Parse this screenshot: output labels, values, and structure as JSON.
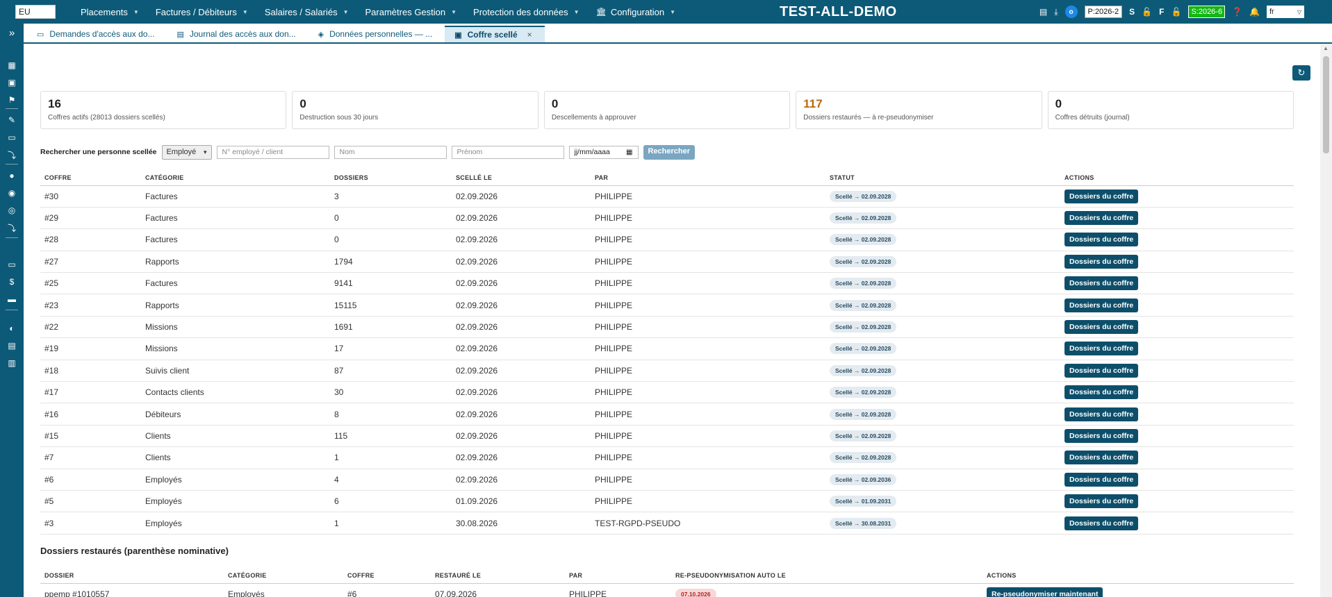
{
  "topbar": {
    "company": "EU",
    "menu": [
      {
        "label": "Placements"
      },
      {
        "label": "Factures / Débiteurs"
      },
      {
        "label": "Salaires / Salariés"
      },
      {
        "label": "Paramètres Gestion"
      },
      {
        "label": "Protection des données"
      },
      {
        "label": "Configuration"
      }
    ],
    "app_title": "TEST-ALL-DEMO",
    "avatar_initial": "o",
    "period": "P:2026-2",
    "s_label": "S",
    "f_label": "F",
    "session": "S:2026-6",
    "language": "fr"
  },
  "tabs": [
    {
      "label": "Demandes d'accès aux do...",
      "icon": "laptop-icon"
    },
    {
      "label": "Journal des accès aux don...",
      "icon": "document-icon"
    },
    {
      "label": "Données personnelles — ...",
      "icon": "shield-icon"
    },
    {
      "label": "Coffre scellé",
      "icon": "vault-icon",
      "active": true
    }
  ],
  "kpis": [
    {
      "value": "16",
      "label": "Coffres actifs (28013 dossiers scellés)"
    },
    {
      "value": "0",
      "label": "Destruction sous 30 jours"
    },
    {
      "value": "0",
      "label": "Descellements à approuver"
    },
    {
      "value": "117",
      "label": "Dossiers restaurés — à re-pseudonymiser",
      "color": "#b86a0a"
    },
    {
      "value": "0",
      "label": "Coffres détruits (journal)"
    }
  ],
  "search": {
    "label": "Rechercher une personne scellée",
    "type_value": "Employé",
    "number_placeholder": "N° employé / client",
    "name_placeholder": "Nom",
    "firstname_placeholder": "Prénom",
    "date_placeholder": "jj/mm/aaaa",
    "button": "Rechercher"
  },
  "vaults_table": {
    "headers": [
      "Coffre",
      "Catégorie",
      "Dossiers",
      "Scellé le",
      "Par",
      "Statut",
      "Actions"
    ],
    "action_label": "Dossiers du coffre",
    "rows": [
      {
        "id": "#30",
        "category": "Factures",
        "files": "3",
        "sealed": "02.09.2026",
        "by": "PHILIPPE",
        "status": "Scellé → 02.09.2028"
      },
      {
        "id": "#29",
        "category": "Factures",
        "files": "0",
        "sealed": "02.09.2026",
        "by": "PHILIPPE",
        "status": "Scellé → 02.09.2028"
      },
      {
        "id": "#28",
        "category": "Factures",
        "files": "0",
        "sealed": "02.09.2026",
        "by": "PHILIPPE",
        "status": "Scellé → 02.09.2028"
      },
      {
        "id": "#27",
        "category": "Rapports",
        "files": "1794",
        "sealed": "02.09.2026",
        "by": "PHILIPPE",
        "status": "Scellé → 02.09.2028"
      },
      {
        "id": "#25",
        "category": "Factures",
        "files": "9141",
        "sealed": "02.09.2026",
        "by": "PHILIPPE",
        "status": "Scellé → 02.09.2028"
      },
      {
        "id": "#23",
        "category": "Rapports",
        "files": "15115",
        "sealed": "02.09.2026",
        "by": "PHILIPPE",
        "status": "Scellé → 02.09.2028"
      },
      {
        "id": "#22",
        "category": "Missions",
        "files": "1691",
        "sealed": "02.09.2026",
        "by": "PHILIPPE",
        "status": "Scellé → 02.09.2028"
      },
      {
        "id": "#19",
        "category": "Missions",
        "files": "17",
        "sealed": "02.09.2026",
        "by": "PHILIPPE",
        "status": "Scellé → 02.09.2028"
      },
      {
        "id": "#18",
        "category": "Suivis client",
        "files": "87",
        "sealed": "02.09.2026",
        "by": "PHILIPPE",
        "status": "Scellé → 02.09.2028"
      },
      {
        "id": "#17",
        "category": "Contacts clients",
        "files": "30",
        "sealed": "02.09.2026",
        "by": "PHILIPPE",
        "status": "Scellé → 02.09.2028"
      },
      {
        "id": "#16",
        "category": "Débiteurs",
        "files": "8",
        "sealed": "02.09.2026",
        "by": "PHILIPPE",
        "status": "Scellé → 02.09.2028"
      },
      {
        "id": "#15",
        "category": "Clients",
        "files": "115",
        "sealed": "02.09.2026",
        "by": "PHILIPPE",
        "status": "Scellé → 02.09.2028"
      },
      {
        "id": "#7",
        "category": "Clients",
        "files": "1",
        "sealed": "02.09.2026",
        "by": "PHILIPPE",
        "status": "Scellé → 02.09.2028"
      },
      {
        "id": "#6",
        "category": "Employés",
        "files": "4",
        "sealed": "02.09.2026",
        "by": "PHILIPPE",
        "status": "Scellé → 02.09.2036"
      },
      {
        "id": "#5",
        "category": "Employés",
        "files": "6",
        "sealed": "01.09.2026",
        "by": "PHILIPPE",
        "status": "Scellé → 01.09.2031"
      },
      {
        "id": "#3",
        "category": "Employés",
        "files": "1",
        "sealed": "30.08.2026",
        "by": "TEST-RGPD-PSEUDO",
        "status": "Scellé → 30.08.2031"
      }
    ]
  },
  "restored": {
    "title": "Dossiers restaurés (parenthèse nominative)",
    "headers": [
      "Dossier",
      "Catégorie",
      "Coffre",
      "Restauré le",
      "Par",
      "Re-pseudonymisation auto le",
      "Actions"
    ],
    "action_label": "Re-pseudonymiser maintenant",
    "rows": [
      {
        "file": "ppemp #1010557",
        "category": "Employés",
        "vault": "#6",
        "restored": "07.09.2026",
        "by": "PHILIPPE",
        "auto": "07.10.2026"
      }
    ]
  }
}
